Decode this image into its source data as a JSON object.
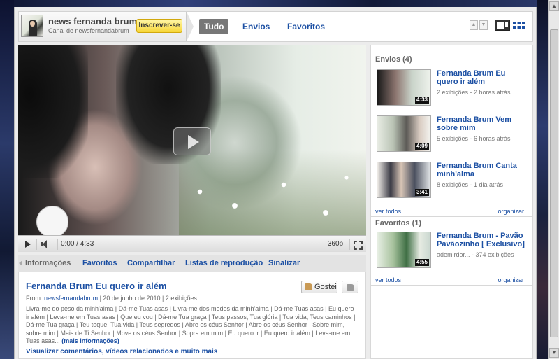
{
  "header": {
    "channel_name": "news fernanda brum",
    "channel_sub": "Canal de newsfernandabrum",
    "subscribe_label": "Inscrever-se",
    "tabs": [
      {
        "label": "Tudo",
        "active": true
      },
      {
        "label": "Envios",
        "active": false
      },
      {
        "label": "Favoritos",
        "active": false
      }
    ],
    "accent_color": "#1b4fa3"
  },
  "player": {
    "time": "0:00 / 4:33",
    "quality": "360p"
  },
  "subtabs": [
    {
      "label": "Informações",
      "active": true
    },
    {
      "label": "Favoritos",
      "active": false
    },
    {
      "label": "Compartilhar",
      "active": false
    },
    {
      "label": "Listas de reprodução",
      "active": false
    },
    {
      "label": "Sinalizar",
      "active": false
    }
  ],
  "info": {
    "title": "Fernanda Brum Eu quero ir além",
    "like_label": "Gostei",
    "from_label": "From:",
    "from_user": "newsfernandabrum",
    "from_rest": "| 20 de junho de 2010 | 2 exibições",
    "lyrics": "Livra-me do peso da minh'alma | Dá-me Tuas asas | Livra-me dos medos da minh'alma | Dá-me Tuas asas | Eu quero ir além | Leva-me em Tuas asas | Que eu vou | Dá-me Tua graça | Teus passos, Tua glória | Tua vida, Teus caminhos | Dá-me Tua graça | Teu toque, Tua vida | Teus segredos | Abre os céus Senhor | Abre os céus Senhor | Sobre mim, sobre mim | Mais de Ti Senhor | Move os céus Senhor | Sopra em mim | Eu quero ir | Eu quero ir além | Leva-me em Tuas asas...",
    "more_info": "(mais informações)",
    "more_link": "Visualizar comentários, vídeos relacionados e muito mais"
  },
  "sidebar": {
    "uploads_title": "Envios (4)",
    "uploads": [
      {
        "title": "Fernanda Brum Eu quero ir além",
        "meta": "2 exibições - 2 horas atrás",
        "duration": "4:33"
      },
      {
        "title": "Fernanda Brum Vem sobre mim",
        "meta": "5 exibições - 6 horas atrás",
        "duration": "4:09"
      },
      {
        "title": "Fernanda Brum Canta minh'alma",
        "meta": "8 exibições - 1 dia atrás",
        "duration": "3:41"
      }
    ],
    "see_all": "ver todos",
    "organize": "organizar",
    "favorites_title": "Favoritos (1)",
    "favorites": [
      {
        "title": "Fernanda Brum - Pavão Pavãozinho [ Exclusivo]",
        "meta": "ademirdor... - 374 exibições",
        "duration": "4:55"
      }
    ]
  }
}
